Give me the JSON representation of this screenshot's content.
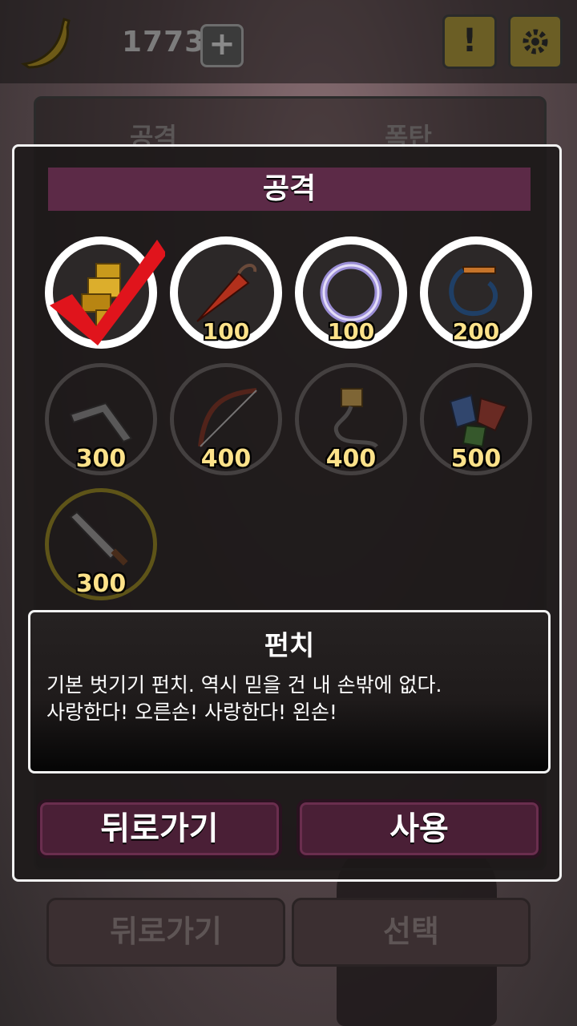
{
  "hud": {
    "coins": "1773",
    "plus_label": "+",
    "notice_label": "!"
  },
  "background": {
    "tab_attack": "공격",
    "tab_bomb": "폭탄",
    "back_label": "뒤로가기",
    "select_label": "선택"
  },
  "modal": {
    "title": "공격",
    "items": [
      {
        "name": "punch",
        "price": "",
        "selected": true,
        "owned": true
      },
      {
        "name": "umbrella",
        "price": "100",
        "owned": true
      },
      {
        "name": "ring",
        "price": "100",
        "owned": true
      },
      {
        "name": "whip",
        "price": "200",
        "owned": true
      },
      {
        "name": "boomerang",
        "price": "300",
        "owned": false
      },
      {
        "name": "bow",
        "price": "400",
        "owned": false
      },
      {
        "name": "rope-fist",
        "price": "400",
        "owned": false
      },
      {
        "name": "feather-glove",
        "price": "500",
        "owned": false
      },
      {
        "name": "sword",
        "price": "300",
        "owned": false
      }
    ],
    "description": {
      "title": "펀치",
      "text": "기본 벗기기 펀치. 역시 믿을 건 내 손밖에 없다.\n사랑한다! 오른손! 사랑한다! 왼손!"
    },
    "back_label": "뒤로가기",
    "use_label": "사용"
  },
  "colors": {
    "accent": "#5c2a47",
    "price": "#fde28a",
    "check": "#e0141c"
  }
}
